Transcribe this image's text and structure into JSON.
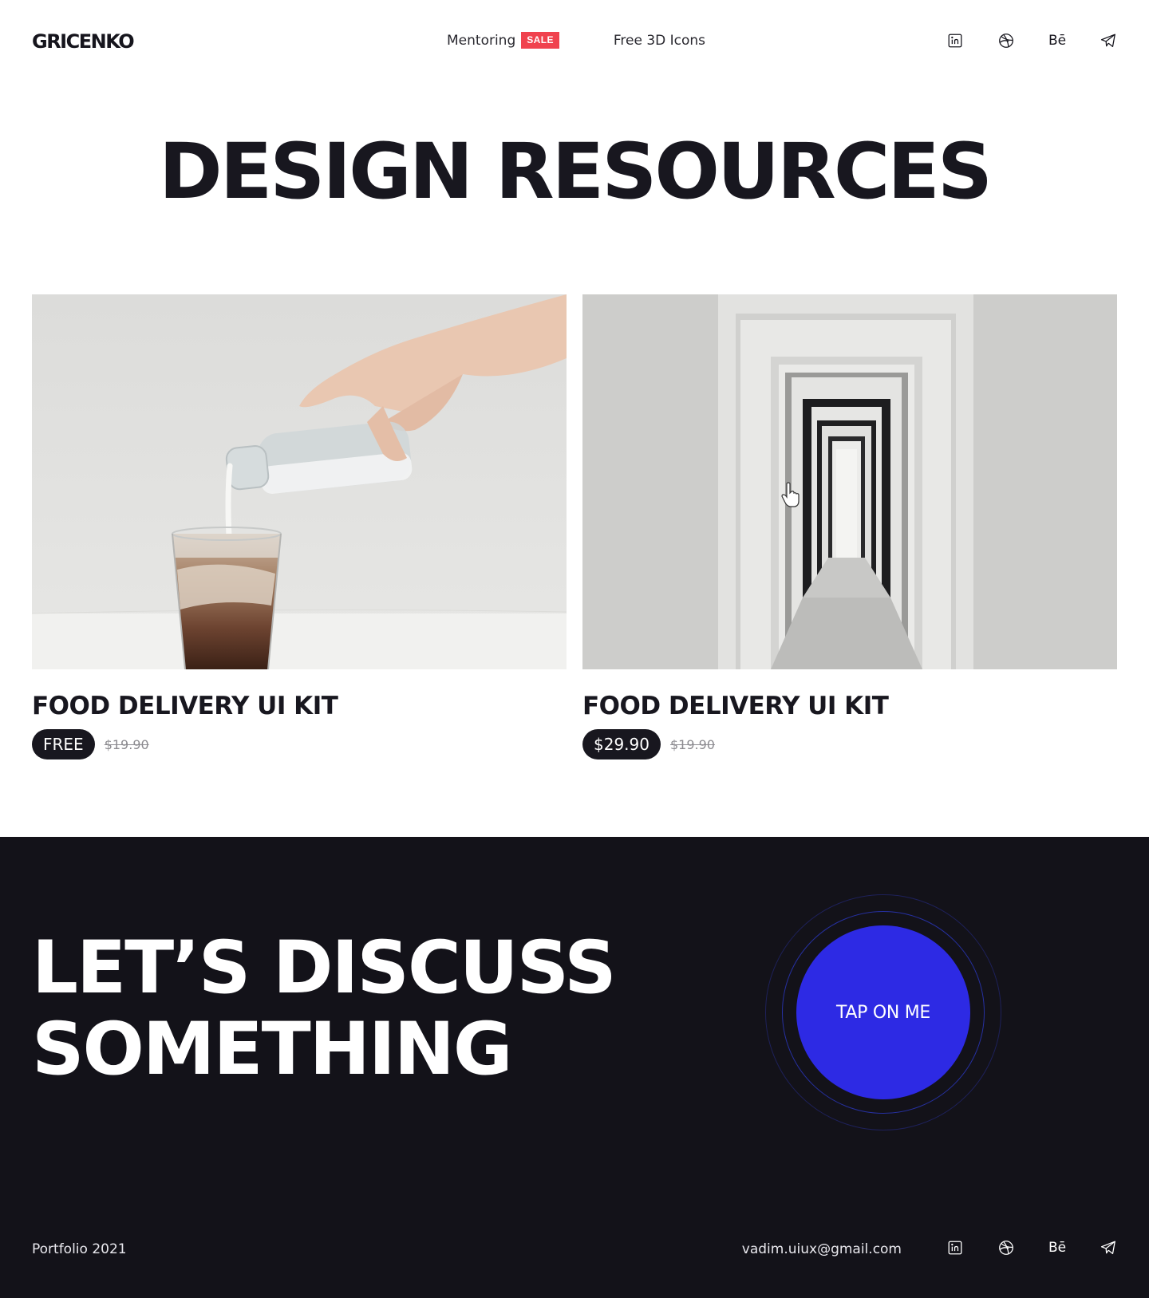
{
  "header": {
    "logo": "GRICENKO",
    "nav": [
      {
        "label": "Mentoring",
        "badge": "SALE"
      },
      {
        "label": "Free 3D Icons"
      }
    ],
    "social": [
      {
        "icon": "linkedin-icon"
      },
      {
        "icon": "dribbble-icon"
      },
      {
        "icon": "behance-icon",
        "label": "Bē"
      },
      {
        "icon": "telegram-icon"
      }
    ]
  },
  "main": {
    "title": "DESIGN RESOURCES",
    "cards": [
      {
        "image": "milk-pouring-into-iced-coffee-photo",
        "title": "FOOD DELIVERY UI KIT",
        "price": "FREE",
        "old_price": "$19.90"
      },
      {
        "image": "receding-doorways-corridor-photo",
        "title": "FOOD DELIVERY UI KIT",
        "price": "$29.90",
        "old_price": "$19.90"
      }
    ]
  },
  "footer": {
    "heading_line1": "LET’S DISCUSS",
    "heading_line2": "SOMETHING",
    "button_label": "TAP ON ME",
    "portfolio": "Portfolio 2021",
    "email": "vadim.uiux@gmail.com",
    "social_behance_label": "Bē"
  },
  "colors": {
    "dark": "#131219",
    "accent": "#2d2ae4",
    "sale": "#f0424e",
    "text": "#18171f"
  }
}
